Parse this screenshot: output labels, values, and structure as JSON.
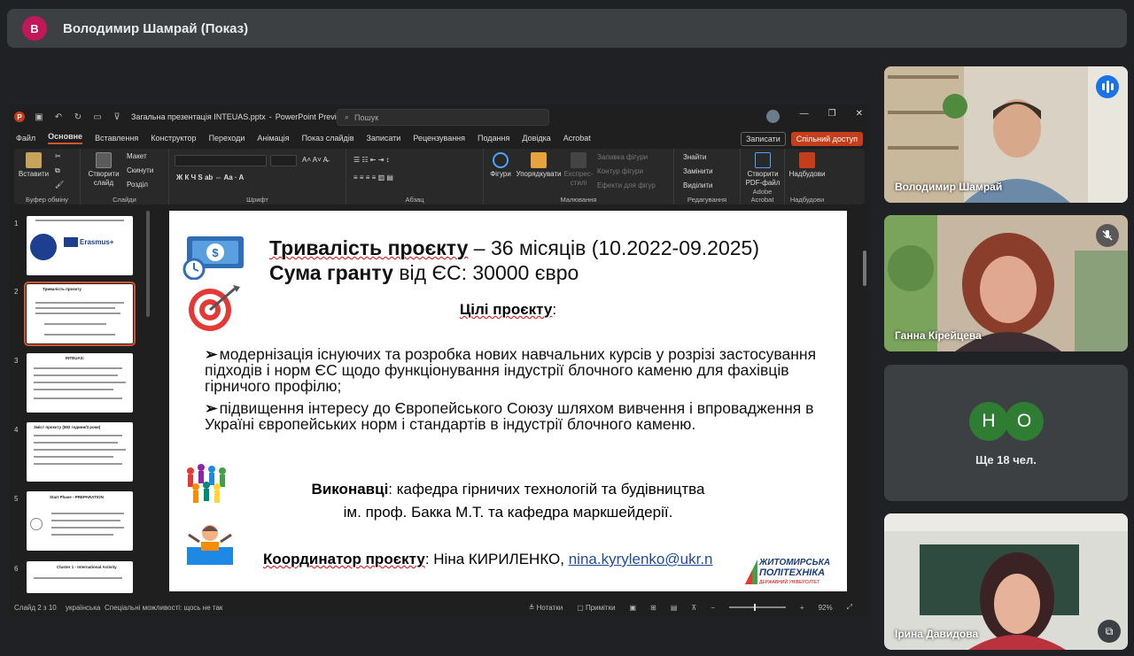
{
  "presenter_bar": {
    "avatar_letter": "В",
    "title": "Володимир Шамрай (Показ)"
  },
  "ppt": {
    "filename": "Загальна презентація INTEUAS.pptx",
    "app_suffix": "PowerPoint Preview",
    "search_placeholder": "Пошук",
    "tabs": [
      "Файл",
      "Основне",
      "Вставлення",
      "Конструктор",
      "Переходи",
      "Анімація",
      "Показ слайдів",
      "Записати",
      "Рецензування",
      "Подання",
      "Довідка",
      "Acrobat"
    ],
    "record_btn": "Записати",
    "share_btn": "Спільний доступ",
    "ribbon": {
      "paste": "Вставити",
      "clipboard": "Буфер обміну",
      "new_slide": "Створити слайд",
      "layout": "Макет",
      "reset": "Скинути",
      "section": "Розділ",
      "slides": "Слайди",
      "font": "Шрифт",
      "paragraph": "Абзац",
      "shapes": "Фігури",
      "arrange": "Упорядкувати",
      "quick_styles": "Експрес-стилі",
      "shape_fill": "Заливка фігури",
      "shape_outline": "Контур фігури",
      "shape_effects": "Ефекти для фігур",
      "drawing": "Малювання",
      "find": "Знайти",
      "replace": "Замінити",
      "select": "Виділити",
      "editing": "Редагування",
      "create_pdf": "Створити PDF-файл",
      "acrobat": "Adobe Acrobat",
      "addins": "Надбудови",
      "addins_group": "Надбудови"
    },
    "thumbnails": [
      {
        "num": "1",
        "caption": "Erasmus+"
      },
      {
        "num": "2",
        "caption": "Тривалість проєкту"
      },
      {
        "num": "3",
        "caption": "INTEUAS:"
      },
      {
        "num": "4",
        "caption": "Зміст проєкту (592 години/3 роки)"
      },
      {
        "num": "5",
        "caption": "Start Phase - PREPARATION"
      },
      {
        "num": "6",
        "caption": "Cluster 1 - International Activity"
      }
    ],
    "slide": {
      "line1_bold": "Тривалість проєкту",
      "line1_rest": " – 36 місяців (10.2022-09.2025)",
      "line2_bold": "Сума гранту",
      "line2_rest": " від ЄС: 30000 євро",
      "goals_title": "Цілі проєкту",
      "goals_colon": ":",
      "bullet1": "модернізація існуючих та розробка нових навчальних курсів у розрізі застосування підходів і норм ЄС щодо функціонування індустрії блочного каменю для фахівців гірничого профілю;",
      "bullet2": "підвищення інтересу до Європейського Союзу шляхом вивчення і впровадження в Україні європейських норм і стандартів в індустрії блочного каменю.",
      "exec_label": "Виконавці",
      "exec_line1": ": кафедра гірничих технологій та будівництва",
      "exec_line2": "ім. проф. Бакка М.Т. та кафедра маркшейдерії.",
      "coord_label": "Координатор проєкту",
      "coord_name": ": Ніна КИРИЛЕНКО, ",
      "coord_email": "nina.kyrylenko@ukr.n",
      "logo_line1": "ЖИТОМИРСЬКА",
      "logo_line2": "ПОЛІТЕХНІКА",
      "logo_line3": "ДЕРЖАВНИЙ УНІВЕРСИТЕТ"
    },
    "status": {
      "slide_pos": "Слайд 2 з 10",
      "language": "українська",
      "accessibility": "Спеціальні можливості: щось не так",
      "notes": "Нотатки",
      "comments": "Примітки",
      "zoom": "92%"
    }
  },
  "participants": [
    {
      "name": "Володимир Шамрай",
      "state": "speaking"
    },
    {
      "name": "Ганна Кірейцева",
      "state": "muted"
    },
    {
      "initials": [
        "Н",
        "О"
      ],
      "more_label": "Ще 18 чел."
    },
    {
      "name": "Ірина Давидова"
    }
  ],
  "colors": {
    "ppt_accent": "#c43e1c",
    "speaker_ring": "#8ab4f8",
    "avatar_green": "#2e7d32"
  }
}
